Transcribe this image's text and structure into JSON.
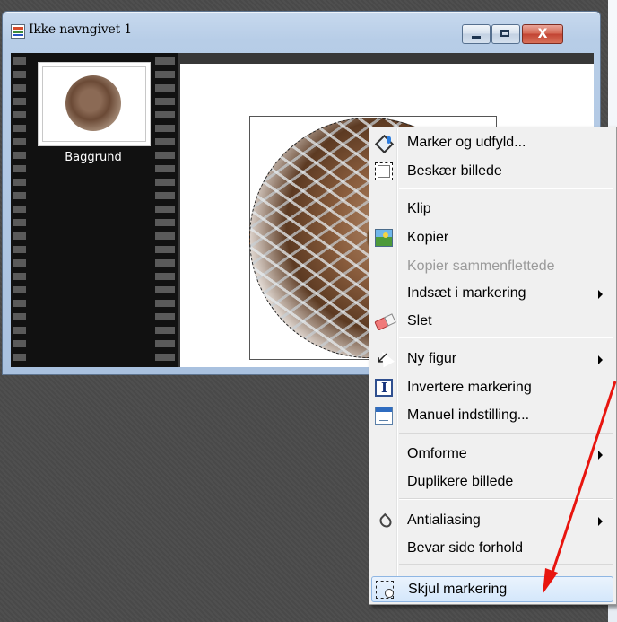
{
  "window": {
    "title": "Ikke navngivet 1",
    "close_glyph": "X"
  },
  "film_strip": {
    "layers": [
      {
        "label": "Baggrund"
      }
    ]
  },
  "context_menu": {
    "items": [
      {
        "label": "Marker og udfyld...",
        "icon": "paint-bucket-icon",
        "enabled": true,
        "submenu": false
      },
      {
        "label": "Beskær billede",
        "icon": "crop-icon",
        "enabled": true,
        "submenu": false
      },
      {
        "label": "Klip",
        "icon": null,
        "enabled": true,
        "submenu": false
      },
      {
        "label": "Kopier",
        "icon": "picture-icon",
        "enabled": true,
        "submenu": false
      },
      {
        "label": "Kopier sammenflettede",
        "icon": null,
        "enabled": false,
        "submenu": false
      },
      {
        "label": "Indsæt i markering",
        "icon": null,
        "enabled": true,
        "submenu": true
      },
      {
        "label": "Slet",
        "icon": "eraser-icon",
        "enabled": true,
        "submenu": false
      },
      {
        "label": "Ny figur",
        "icon": "pointer-icon",
        "enabled": true,
        "submenu": true
      },
      {
        "label": "Invertere markering",
        "icon": "invert-icon",
        "enabled": true,
        "submenu": false
      },
      {
        "label": "Manuel indstilling...",
        "icon": "window-settings-icon",
        "enabled": true,
        "submenu": false
      },
      {
        "label": "Omforme",
        "icon": null,
        "enabled": true,
        "submenu": true
      },
      {
        "label": "Duplikere billede",
        "icon": null,
        "enabled": true,
        "submenu": false
      },
      {
        "label": "Antialiasing",
        "icon": "drop-icon",
        "enabled": true,
        "submenu": true
      },
      {
        "label": "Bevar side forhold",
        "icon": null,
        "enabled": true,
        "submenu": false
      },
      {
        "label": "Skjul markering",
        "icon": "hide-selection-icon",
        "enabled": true,
        "submenu": false,
        "highlighted": true
      }
    ]
  },
  "annotation": {
    "arrow_color": "#e8150f"
  }
}
